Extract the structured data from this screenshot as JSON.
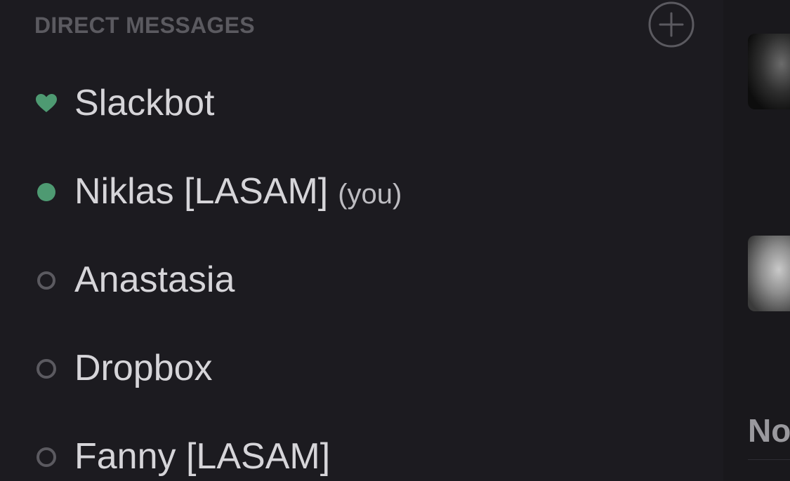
{
  "sidebar": {
    "section_title": "DIRECT MESSAGES",
    "add_icon": "plus-circle-icon",
    "items": [
      {
        "name": "Slackbot",
        "suffix": "",
        "presence": "heart",
        "color": "#4e9a72"
      },
      {
        "name": "Niklas [LASAM]",
        "suffix": "(you)",
        "presence": "online",
        "color": "#4e9a72"
      },
      {
        "name": "Anastasia",
        "suffix": "",
        "presence": "away",
        "color": "#5b5a60"
      },
      {
        "name": "Dropbox",
        "suffix": "",
        "presence": "away",
        "color": "#5b5a60"
      },
      {
        "name": "Fanny [LASAM]",
        "suffix": "",
        "presence": "away",
        "color": "#5b5a60"
      }
    ]
  },
  "main": {
    "heading_partial": "No"
  },
  "colors": {
    "background": "#1c1b20",
    "text": "#d6d5d9",
    "muted": "#5b5a60",
    "accent_green": "#4e9a72"
  }
}
